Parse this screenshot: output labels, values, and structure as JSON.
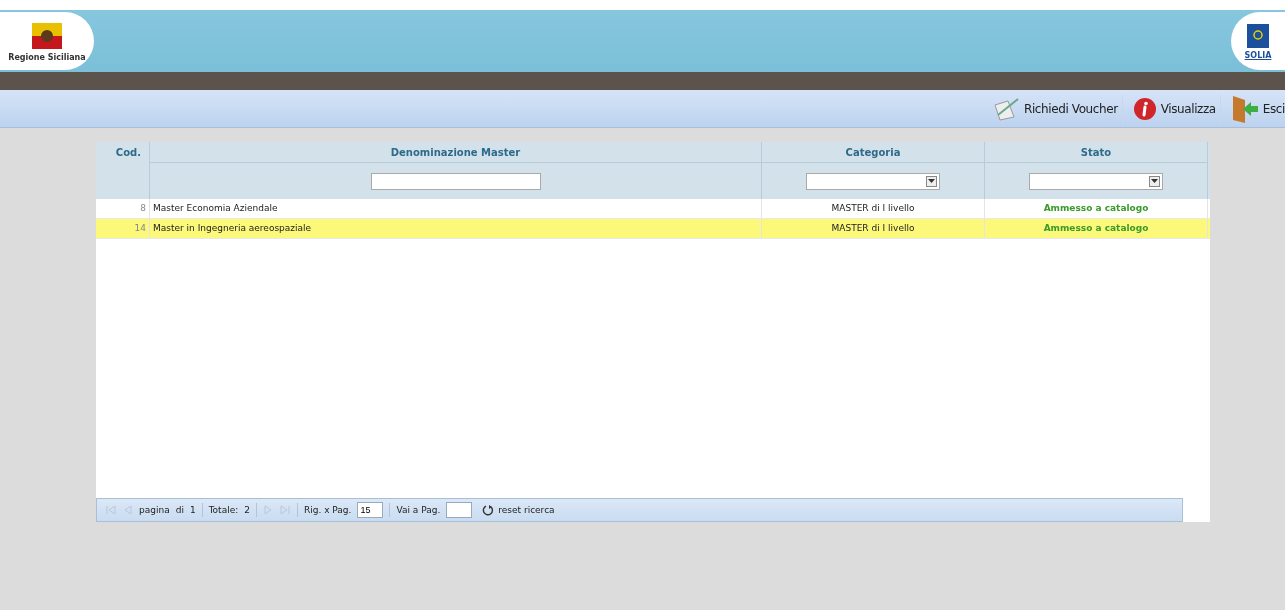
{
  "header": {
    "left_logo_caption": "Regione Siciliana",
    "right_logo_caption": "SOLIA"
  },
  "toolbar": {
    "buttons": [
      {
        "label": "Richiedi Voucher",
        "kind": "voucher"
      },
      {
        "label": "Visualizza",
        "kind": "info"
      },
      {
        "label": "Esci",
        "kind": "exit"
      }
    ]
  },
  "table": {
    "columns": [
      {
        "label": "Cod.",
        "kind": "plain"
      },
      {
        "label": "Denominazione Master",
        "kind": "text"
      },
      {
        "label": "Categoria",
        "kind": "select"
      },
      {
        "label": "Stato",
        "kind": "select"
      }
    ],
    "rows": [
      {
        "cod": "8",
        "name": "Master Economia Aziendale",
        "category": "MASTER di I livello",
        "status": "Ammesso a catalogo",
        "selected": false
      },
      {
        "cod": "14",
        "name": "Master in Ingegneria aereospaziale",
        "category": "MASTER di I livello",
        "status": "Ammesso a catalogo",
        "selected": true
      }
    ]
  },
  "pager": {
    "page_label": "pagina",
    "of_label": "di",
    "pages": "1",
    "total_label": "Totale:",
    "total": "2",
    "rows_label": "Rig. x Pag.",
    "rows_value": "15",
    "goto_label": "Vai a Pag.",
    "reset_label": "reset ricerca"
  }
}
